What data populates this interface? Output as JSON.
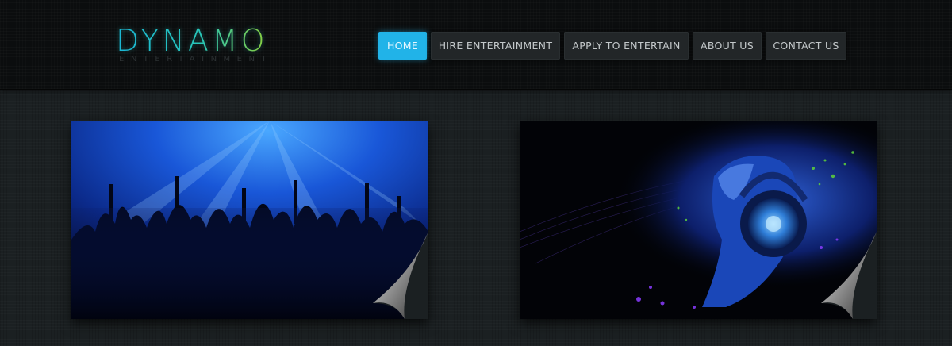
{
  "logo": {
    "title": "DYNAMO",
    "subtitle": "ENTERTAINMENT"
  },
  "nav": {
    "items": [
      {
        "label": "HOME",
        "active": true
      },
      {
        "label": "HIRE ENTERTAINMENT",
        "active": false
      },
      {
        "label": "APPLY TO ENTERTAIN",
        "active": false
      },
      {
        "label": "ABOUT US",
        "active": false
      },
      {
        "label": "CONTACT US",
        "active": false
      }
    ]
  },
  "colors": {
    "accent": "#21b3e8",
    "header_bg": "#0b0d0e",
    "page_bg": "#1b2022",
    "logo_gradient": [
      "#1bb7d6",
      "#8ccf3b"
    ]
  },
  "images": [
    {
      "subject": "concert-crowd-photo"
    },
    {
      "subject": "woman-headphones-art"
    }
  ]
}
